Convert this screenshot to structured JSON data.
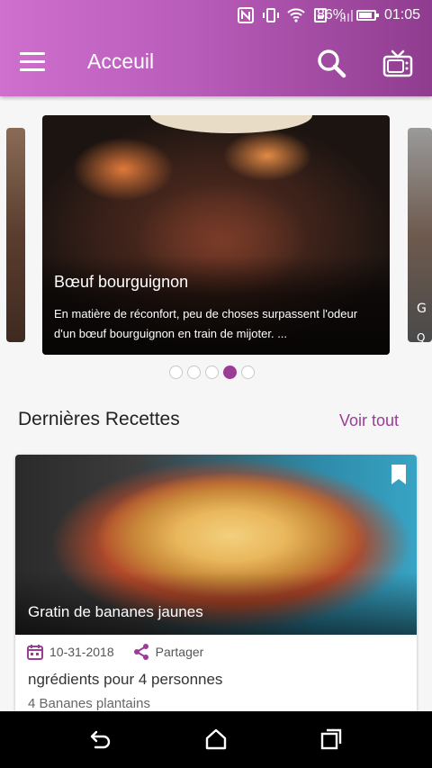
{
  "status_bar": {
    "battery": "86%",
    "time": "01:05",
    "icons": [
      "nfc-icon",
      "vibrate-icon",
      "wifi-icon",
      "data-icon",
      "signal-icon"
    ]
  },
  "app_bar": {
    "title": "Acceuil",
    "icons": [
      "menu-icon",
      "search-icon",
      "tv-icon"
    ]
  },
  "carousel": {
    "slides": [
      {
        "title": "Bœuf bourguignon",
        "description": "En matière de réconfort, peu de choses surpassent l'odeur d'un bœuf bourguignon en train de mijoter. ..."
      }
    ],
    "peek_right_chars": [
      "G",
      "Q"
    ],
    "dot_count": 5,
    "active_dot": 3
  },
  "section": {
    "title": "Dernières Recettes",
    "see_all": "Voir tout"
  },
  "recipe_card": {
    "title": "Gratin de bananes jaunes",
    "date": "10-31-2018",
    "share": "Partager",
    "subtitle": "ngrédients pour 4 personnes",
    "line2": "4 Bananes plantains"
  },
  "colors": {
    "accent": "#9a3d97",
    "header_gradient_start": "#cf6fce",
    "header_gradient_end": "#8f3c8f"
  }
}
